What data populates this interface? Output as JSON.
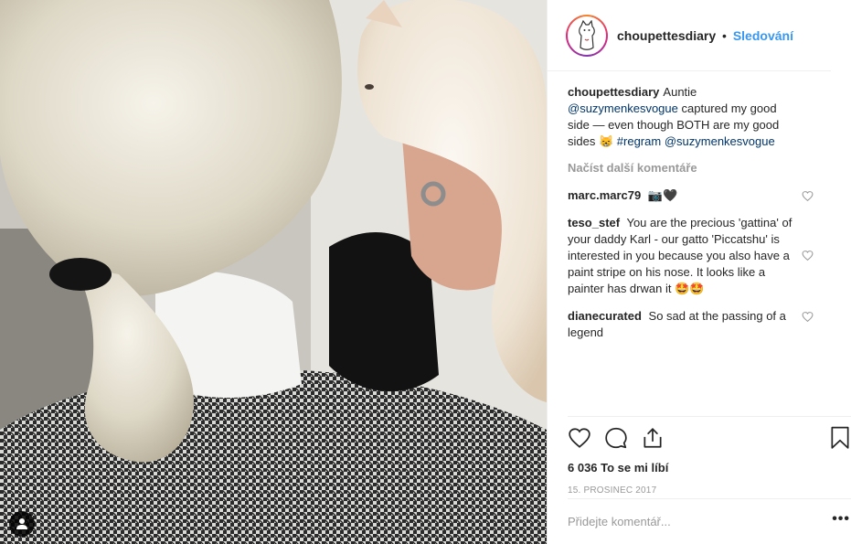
{
  "post": {
    "image_alt": "Woman with platinum ponytail and houndstooth jacket holding a white cat",
    "account": {
      "username": "choupettesdiary",
      "separator": "•",
      "follow_label": "Sledování",
      "avatar_icon": "cat-illustration-avatar"
    },
    "caption": {
      "username": "choupettesdiary",
      "text_1": "Auntie",
      "mention_1": "@suzymenkesvogue",
      "text_2": "captured my good side — even though BOTH are my good sides 😸",
      "hashtag": "#regram",
      "mention_2": "@suzymenkesvogue"
    },
    "load_more_label": "Načíst další komentáře",
    "comments": [
      {
        "username": "marc.marc79",
        "text": "📷🖤"
      },
      {
        "username": "teso_stef",
        "text": "You are the precious 'gattina' of your daddy Karl - our gatto 'Piccatshu' is interested in you because you also have a paint stripe on his nose. It looks like a painter has drwan it 🤩🤩"
      },
      {
        "username": "dianecurated",
        "text": "So sad at the passing of a legend"
      }
    ],
    "likes": "6 036 To se mi líbí",
    "date": "15. PROSINEC 2017",
    "add_comment_placeholder": "Přidejte komentář...",
    "more_label": "•••",
    "colors": {
      "link": "#003569",
      "follow": "#3897f0",
      "muted": "#999999",
      "text": "#262626"
    }
  }
}
